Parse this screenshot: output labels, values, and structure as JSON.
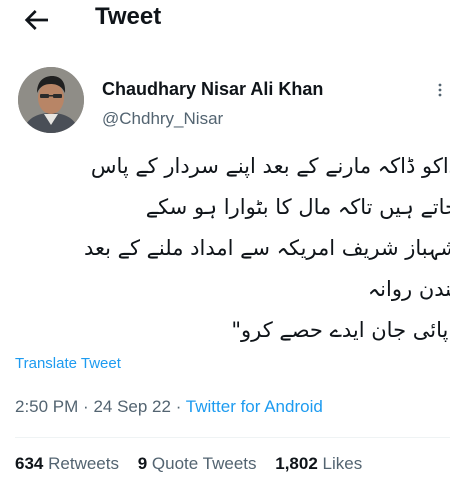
{
  "header": {
    "title": "Tweet"
  },
  "author": {
    "name": "Chaudhary Nisar Ali Khan",
    "handle": "@Chdhry_Nisar"
  },
  "tweet": {
    "lines": [
      "ڈاکو ڈاکہ مارنے کے بعد اپنے سردار کے پاس",
      "جاتے ہیں تاکہ مال کا بٹوارا ہو سکے",
      "شہباز شریف امریکہ سے امداد ملنے کے بعد",
      "لندن روانہ",
      "\"پائی جان ایدے حصے کرو\""
    ],
    "translate_label": "Translate Tweet",
    "time": "2:50 PM",
    "separator": "·",
    "date": "24 Sep 22",
    "source": "Twitter for Android"
  },
  "stats": {
    "retweets": {
      "count": "634",
      "label": "Retweets"
    },
    "quote_tweets": {
      "count": "9",
      "label": "Quote Tweets"
    },
    "likes": {
      "count": "1,802",
      "label": "Likes"
    }
  },
  "colors": {
    "accent": "#1d9bf0",
    "text": "#0f1419",
    "secondary": "#536471"
  },
  "icons": {
    "back": "back-arrow-icon",
    "more": "more-icon"
  }
}
